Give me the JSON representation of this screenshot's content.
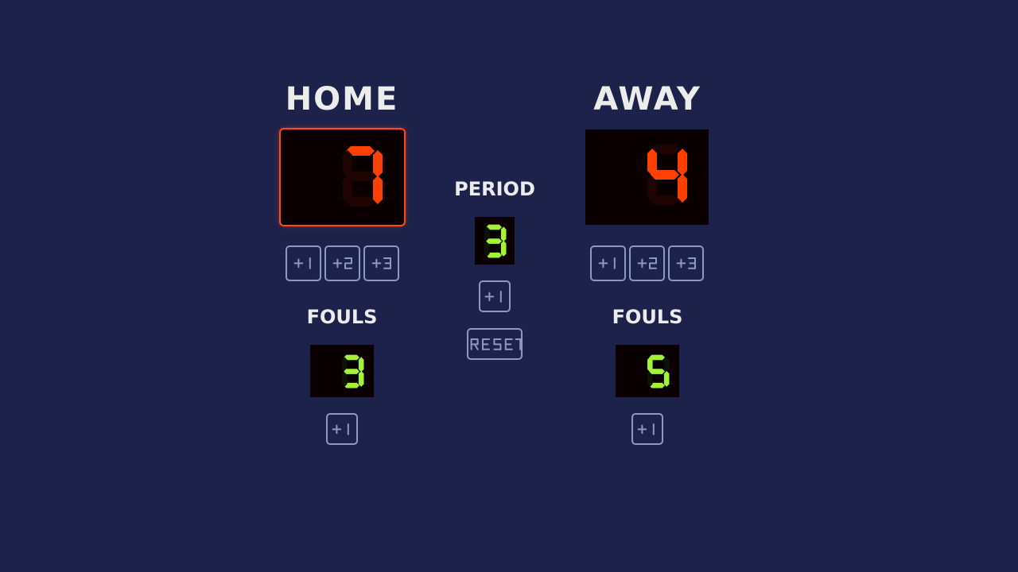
{
  "home": {
    "title": "HOME",
    "score": "7",
    "score_buttons": [
      "+1",
      "+2",
      "+3"
    ],
    "fouls_label": "FOULS",
    "fouls": "3",
    "foul_button": "+1"
  },
  "away": {
    "title": "AWAY",
    "score": "4",
    "score_buttons": [
      "+1",
      "+2",
      "+3"
    ],
    "fouls_label": "FOULS",
    "fouls": "5",
    "foul_button": "+1"
  },
  "period": {
    "label": "PERIOD",
    "value": "3",
    "button": "+1",
    "reset": "RESET"
  },
  "colors": {
    "background": "#1c2249",
    "score_digit": "#ff4000",
    "small_digit": "#a4f237",
    "selected_border": "#ff4a1a",
    "button_border": "#8f98c4"
  }
}
